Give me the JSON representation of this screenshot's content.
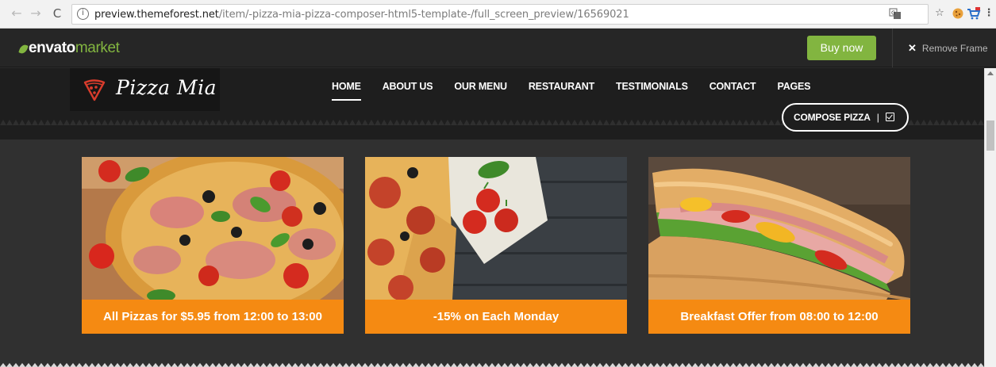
{
  "browser": {
    "url_host": "preview.themeforest.net",
    "url_path": "/item/-pizza-mia-pizza-composer-html5-template-/full_screen_preview/16569021",
    "info_glyph": "i",
    "back_icon": "←",
    "forward_icon": "→",
    "reload_icon": "C",
    "star_icon": "☆",
    "menu_icon": "⋮"
  },
  "envato": {
    "logo_word1": "envato",
    "logo_word2": "market",
    "buy_label": "Buy now",
    "remove_frame_icon": "✕",
    "remove_frame_label": "Remove Frame",
    "accent": "#82b540"
  },
  "site": {
    "logo_text": "Pizza Mia",
    "nav": [
      {
        "label": "HOME",
        "active": true
      },
      {
        "label": "ABOUT US"
      },
      {
        "label": "OUR MENU"
      },
      {
        "label": "RESTAURANT"
      },
      {
        "label": "TESTIMONIALS"
      },
      {
        "label": "CONTACT"
      },
      {
        "label": "PAGES"
      }
    ],
    "compose_label": "COMPOSE PIZZA",
    "compose_separator": "|",
    "accent": "#f58a12"
  },
  "cards": [
    {
      "caption": "All Pizzas for $5.95 from 12:00 to 13:00",
      "image": "pizza-photo"
    },
    {
      "caption": "-15% on Each Monday",
      "image": "pizza-tomatoes-photo"
    },
    {
      "caption": "Breakfast Offer from 08:00 to 12:00",
      "image": "sandwich-photo"
    }
  ]
}
